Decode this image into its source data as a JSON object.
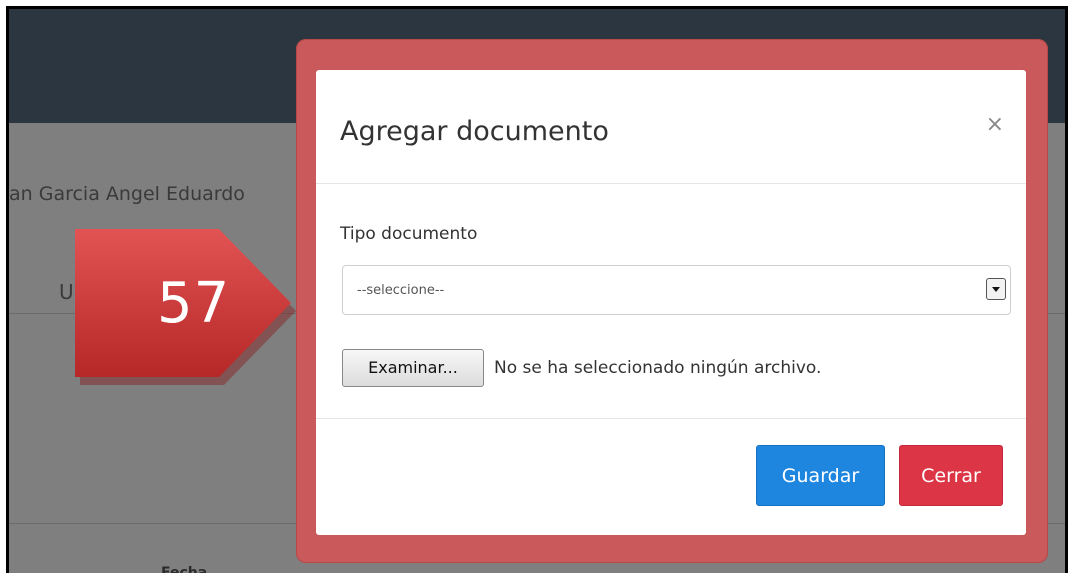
{
  "background": {
    "person_name": "an Garcia Angel Eduardo",
    "partial_tab_letter": "U",
    "column_header": "Fecha"
  },
  "callout": {
    "number": "57",
    "color": "#d23a3a"
  },
  "modal": {
    "title": "Agregar documento",
    "close_symbol": "×",
    "field_label": "Tipo documento",
    "select_value": "--seleccione--",
    "browse_label": "Examinar...",
    "file_status": "No se ha seleccionado ningún archivo.",
    "save_label": "Guardar",
    "cancel_label": "Cerrar"
  },
  "colors": {
    "highlight_frame": "#c9595a",
    "primary_button": "#1f86e0",
    "danger_button": "#dc3545",
    "top_bar": "#2c3640"
  }
}
